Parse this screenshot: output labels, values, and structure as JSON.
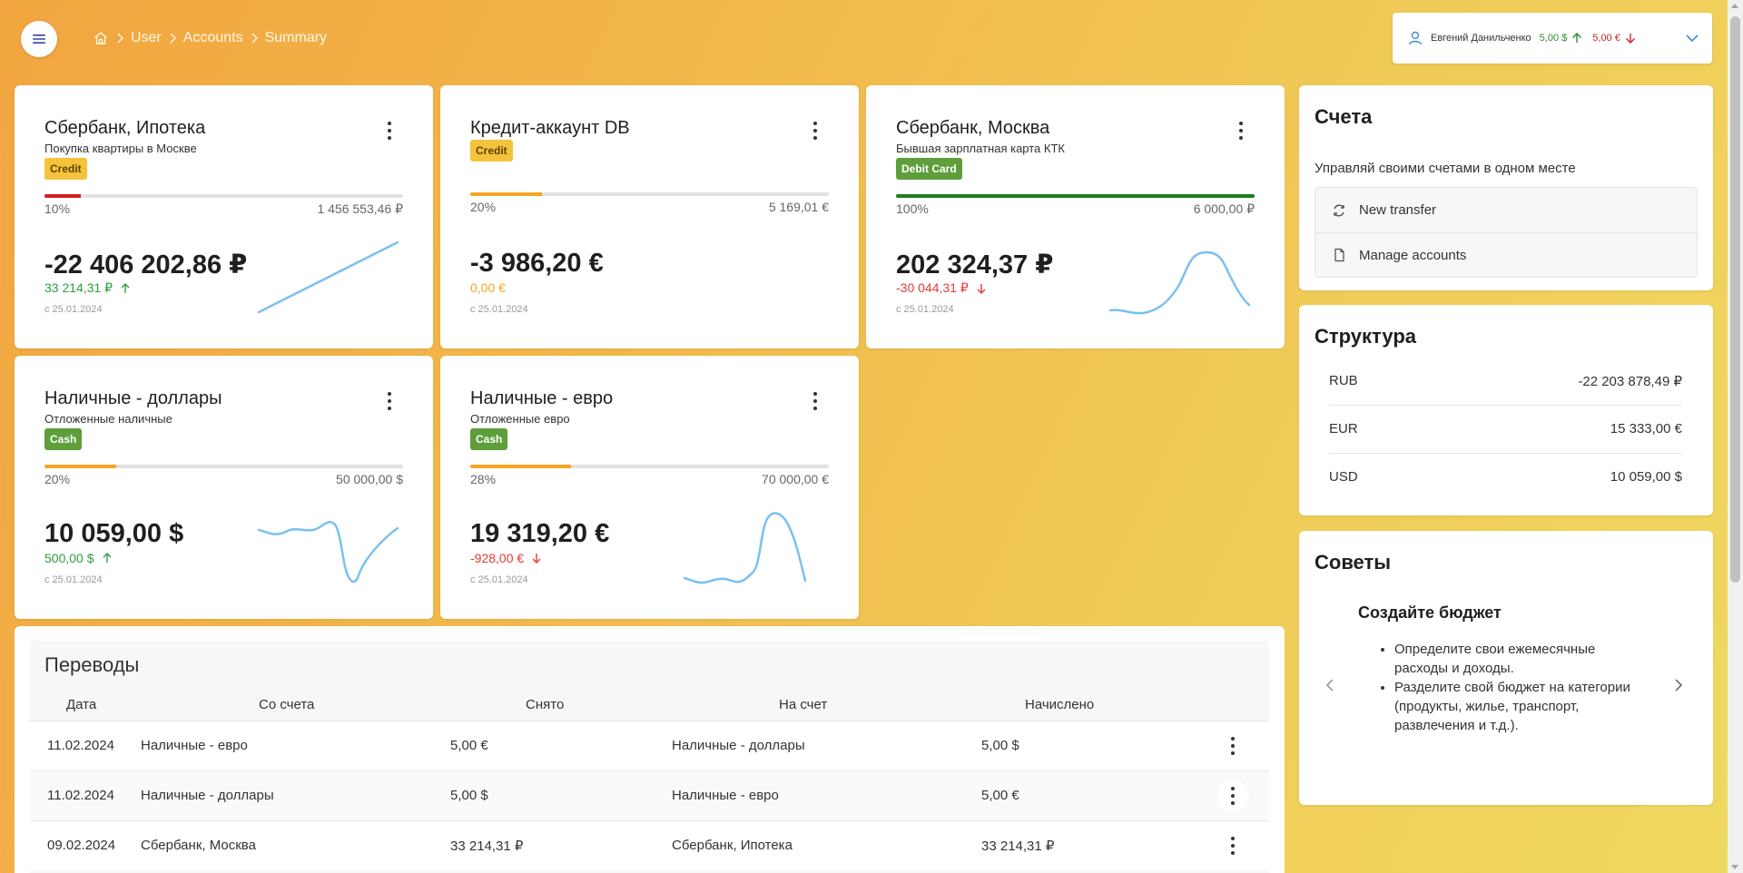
{
  "breadcrumb": {
    "items": [
      "User",
      "Accounts",
      "Summary"
    ]
  },
  "user": {
    "name": "Евгений Данильченко",
    "income": "5,00 $",
    "expense": "5,00 €"
  },
  "accounts": [
    {
      "name": "Сбербанк, Ипотека",
      "desc": "Покупка квартиры в Москве",
      "type": "Credit",
      "progress_pct": "10%",
      "progress": 0.1,
      "limit": "1 456 553,46 ₽",
      "balance": "-22 406 202,86 ₽",
      "change": "33 214,31 ₽",
      "change_dir": "up",
      "since": "с 25.01.2024",
      "bar_color": "#d32020"
    },
    {
      "name": "Кредит-аккаунт DB",
      "desc": "",
      "type": "Credit",
      "progress_pct": "20%",
      "progress": 0.2,
      "limit": "5 169,01 €",
      "balance": "-3 986,20 €",
      "change": "0,00 €",
      "change_dir": "none",
      "since": "с 25.01.2024",
      "bar_color": "#f5a623"
    },
    {
      "name": "Сбербанк, Москва",
      "desc": "Бывшая зарплатная карта КТК",
      "type": "Debit Card",
      "progress_pct": "100%",
      "progress": 1.0,
      "limit": "6 000,00 ₽",
      "balance": "202 324,37 ₽",
      "change": "-30 044,31 ₽",
      "change_dir": "down",
      "since": "с 25.01.2024",
      "bar_color": "#1f7a1f"
    },
    {
      "name": "Наличные - доллары",
      "desc": "Отложенные наличные",
      "type": "Cash",
      "progress_pct": "20%",
      "progress": 0.2,
      "limit": "50 000,00 $",
      "balance": "10 059,00 $",
      "change": "500,00 $",
      "change_dir": "up",
      "since": "с 25.01.2024",
      "bar_color": "#f5a623"
    },
    {
      "name": "Наличные - евро",
      "desc": "Отложенные евро",
      "type": "Cash",
      "progress_pct": "28%",
      "progress": 0.28,
      "limit": "70 000,00 €",
      "balance": "19 319,20 €",
      "change": "-928,00 €",
      "change_dir": "down",
      "since": "с 25.01.2024",
      "bar_color": "#f5a623"
    }
  ],
  "accounts_panel": {
    "title": "Счета",
    "subtitle": "Управляй своими счетами в одном месте",
    "actions": [
      "New transfer",
      "Manage accounts"
    ]
  },
  "structure": {
    "title": "Структура",
    "rows": [
      {
        "currency": "RUB",
        "amount": "-22 203 878,49 ₽"
      },
      {
        "currency": "EUR",
        "amount": "15 333,00 €"
      },
      {
        "currency": "USD",
        "amount": "10 059,00 $"
      }
    ]
  },
  "tips": {
    "title": "Советы",
    "heading": "Создайте бюджет",
    "items": [
      "Определите свои ежемесячные расходы и доходы.",
      "Разделите свой бюджет на категории (продукты, жилье, транспорт, развлечения и т.д.)."
    ]
  },
  "transfers": {
    "title": "Переводы",
    "columns": [
      "Дата",
      "Со счета",
      "Снято",
      "На счет",
      "Начислено"
    ],
    "rows": [
      {
        "date": "11.02.2024",
        "from": "Наличные - евро",
        "out": "5,00 €",
        "to": "Наличные - доллары",
        "in": "5,00 $"
      },
      {
        "date": "11.02.2024",
        "from": "Наличные - доллары",
        "out": "5,00 $",
        "to": "Наличные - евро",
        "in": "5,00 €"
      },
      {
        "date": "09.02.2024",
        "from": "Сбербанк, Москва",
        "out": "33 214,31 ₽",
        "to": "Сбербанк, Ипотека",
        "in": "33 214,31 ₽"
      }
    ]
  },
  "colors": {
    "positive": "#2e9e3e",
    "negative": "#e53935",
    "neutral": "#f5a623",
    "spark": "#7cc0ee"
  },
  "icons": [
    "menu-icon",
    "home-icon",
    "chevron-right-icon",
    "user-icon",
    "arrow-up-icon",
    "arrow-down-icon",
    "chevron-down-icon",
    "more-vert-icon",
    "refresh-icon",
    "file-icon",
    "chevron-left-icon"
  ]
}
